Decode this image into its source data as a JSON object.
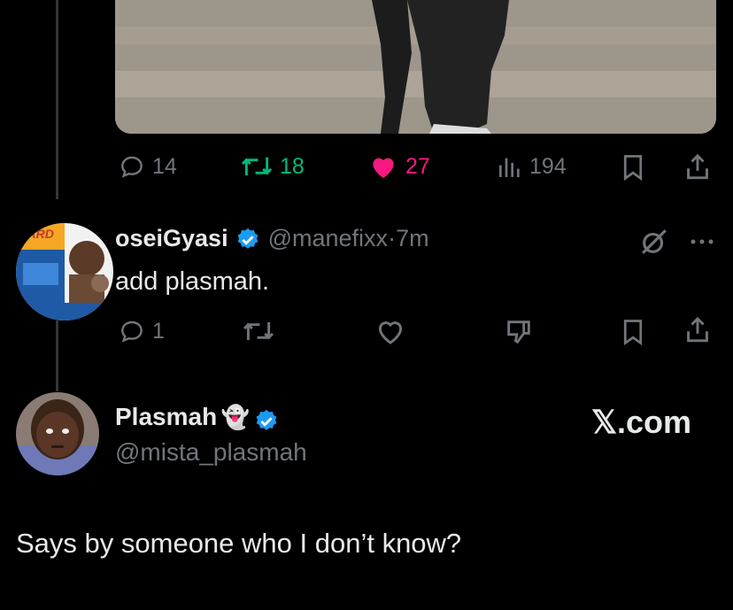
{
  "post": {
    "actions": {
      "replies": "14",
      "reposts": "18",
      "likes": "27",
      "views": "194"
    }
  },
  "reply": {
    "display_name": "oseiGyasi",
    "handle": "@manefixx",
    "separator": "·",
    "time": "7m",
    "text": "add plasmah.",
    "reply_count": "1",
    "avatar_text": "ZARD"
  },
  "quoted": {
    "display_name": "Plasmah",
    "emoji": "👻",
    "handle": "@mista_plasmah",
    "watermark": "𝕏.com",
    "text": "Says by someone who I don’t know?"
  },
  "colors": {
    "background": "#000000",
    "muted": "#71767b",
    "repost": "#00ba7c",
    "like": "#f91880",
    "verified": "#1d9bf0"
  }
}
